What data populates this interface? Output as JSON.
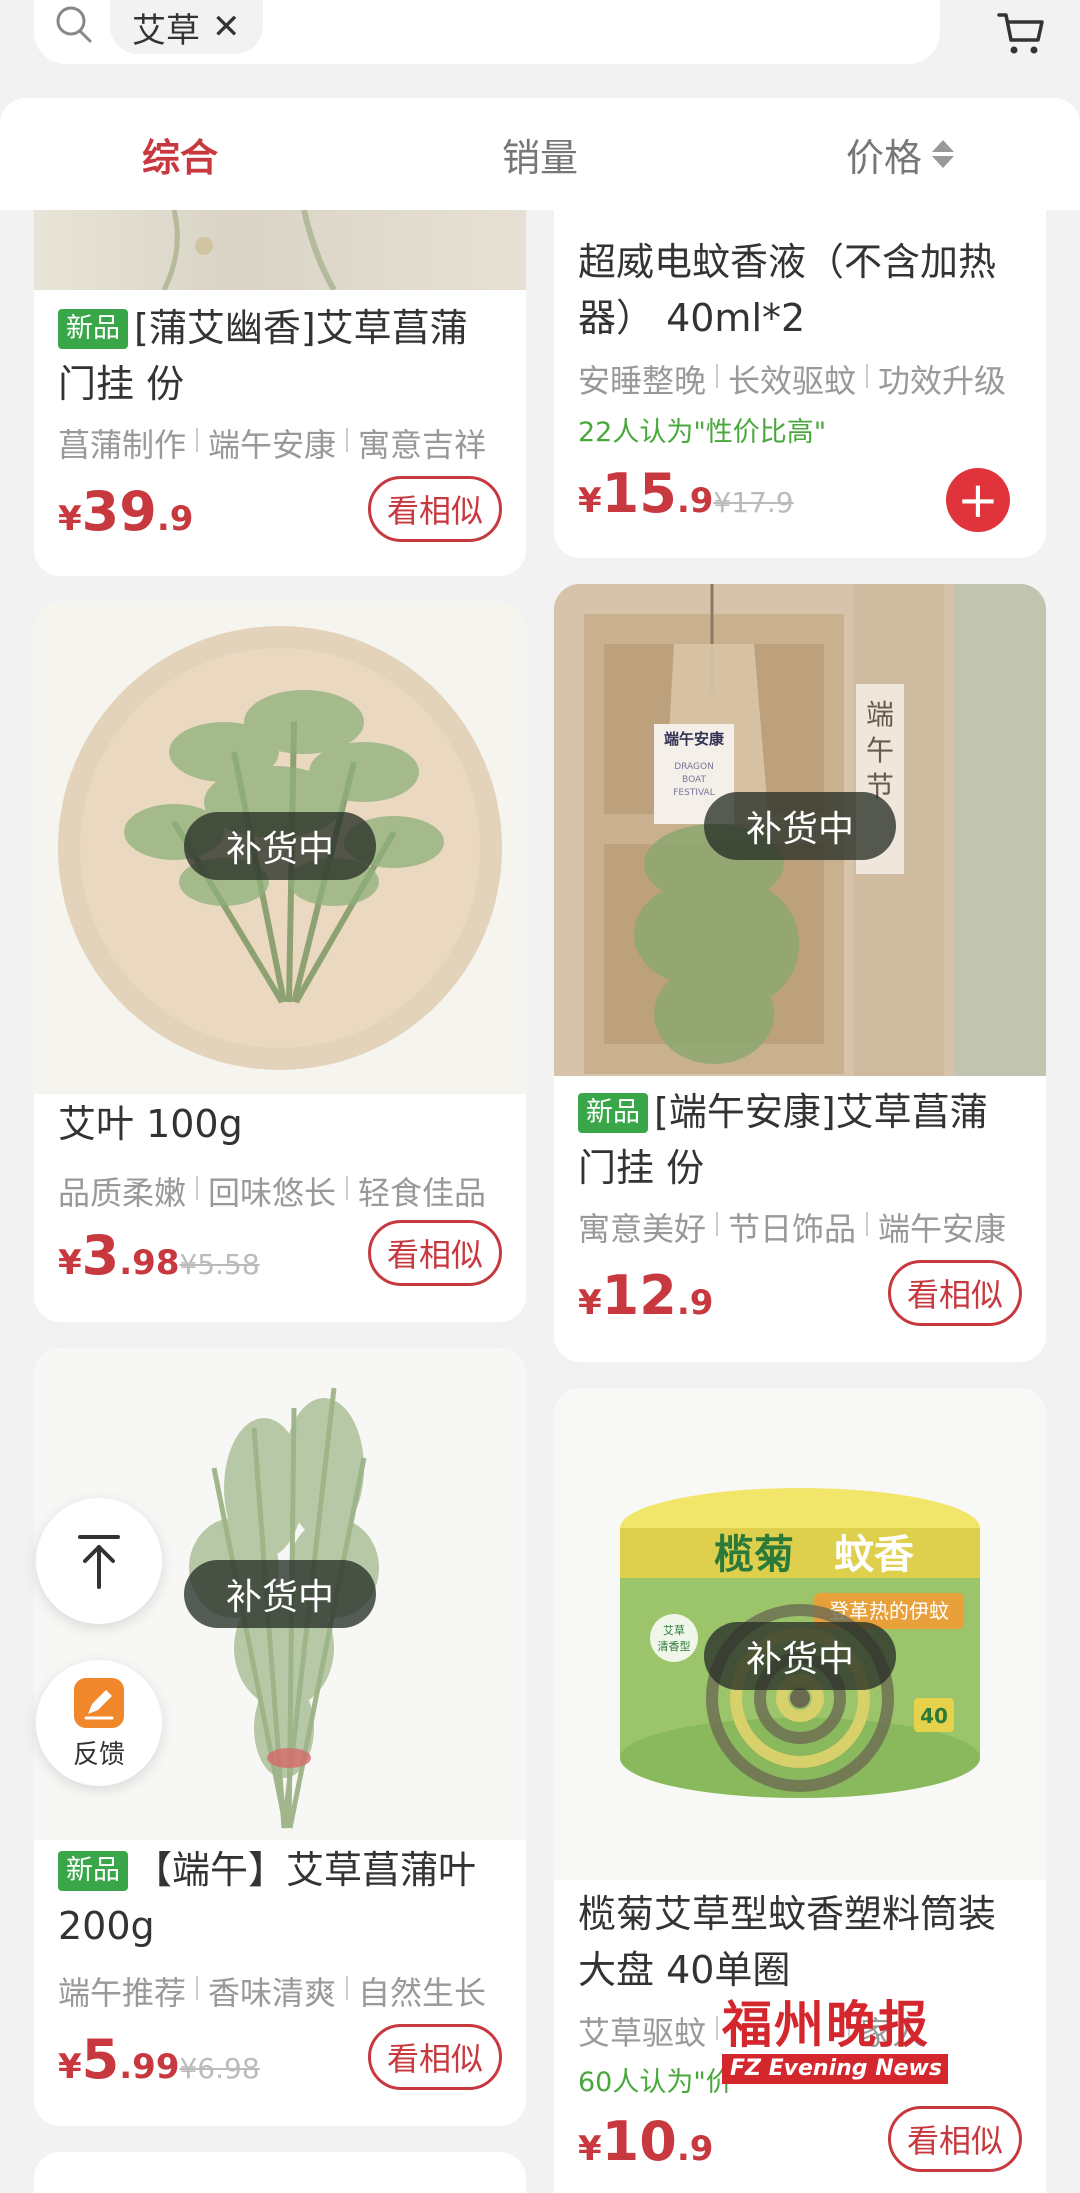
{
  "search": {
    "query": "艾草"
  },
  "sort_tabs": [
    "综合",
    "销量",
    "价格"
  ],
  "products": [
    {
      "badge": "新品",
      "title": "[蒲艾幽香]艾草菖蒲门挂 份",
      "tags": [
        "菖蒲制作",
        "端午安康",
        "寓意吉祥"
      ],
      "price_currency": "¥",
      "price_int": "39",
      "price_dec": ".9",
      "old_price": "",
      "button": "看相似"
    },
    {
      "badge": "",
      "title": "超威电蚊香液（不含加热器） 40ml*2",
      "tags": [
        "安睡整晚",
        "长效驱蚊",
        "功效升级"
      ],
      "note": "22人认为\"性价比高\"",
      "price_currency": "¥",
      "price_int": "15",
      "price_dec": ".9",
      "old_price": "¥17.9",
      "button": "+"
    },
    {
      "badge": "",
      "title": "艾叶 100g",
      "tags": [
        "品质柔嫩",
        "回味悠长",
        "轻食佳品"
      ],
      "status": "补货中",
      "price_currency": "¥",
      "price_int": "3",
      "price_dec": ".98",
      "old_price": "¥5.58",
      "button": "看相似"
    },
    {
      "badge": "新品",
      "title": "[端午安康]艾草菖蒲门挂 份",
      "tags": [
        "寓意美好",
        "节日饰品",
        "端午安康"
      ],
      "status": "补货中",
      "image_text": {
        "card": "端午安康",
        "en": "DRAGON BOAT FESTIVAL",
        "wood": "端午节"
      },
      "price_currency": "¥",
      "price_int": "12",
      "price_dec": ".9",
      "old_price": "",
      "button": "看相似"
    },
    {
      "badge": "新品",
      "title": "【端午】艾草菖蒲叶200g",
      "tags": [
        "端午推荐",
        "香味清爽",
        "自然生长"
      ],
      "status": "补货中",
      "price_currency": "¥",
      "price_int": "5",
      "price_dec": ".99",
      "old_price": "¥6.98",
      "button": "看相似"
    },
    {
      "badge": "",
      "title": "榄菊艾草型蚊香塑料筒装大盘 40单圈",
      "tags": [
        "艾草驱蚊",
        "",
        ""
      ],
      "tags_visible": "艾草驱蚊",
      "tags_tail": "家人",
      "note": "60人认为\"价",
      "status": "补货中",
      "image_text": {
        "brand": "榄菊 蚊香",
        "type": "艾草清香型",
        "slogan": "登革热的伊蚊",
        "count": "40"
      },
      "price_currency": "¥",
      "price_int": "10",
      "price_dec": ".9",
      "old_price": "",
      "button": "看相似"
    }
  ],
  "floating": {
    "feedback_label": "反馈"
  },
  "watermark": {
    "cn": "福州晚报",
    "en": "FZ Evening News"
  },
  "colors": {
    "accent": "#c8383f",
    "green": "#3aa64a",
    "background": "#f2f2f2"
  }
}
